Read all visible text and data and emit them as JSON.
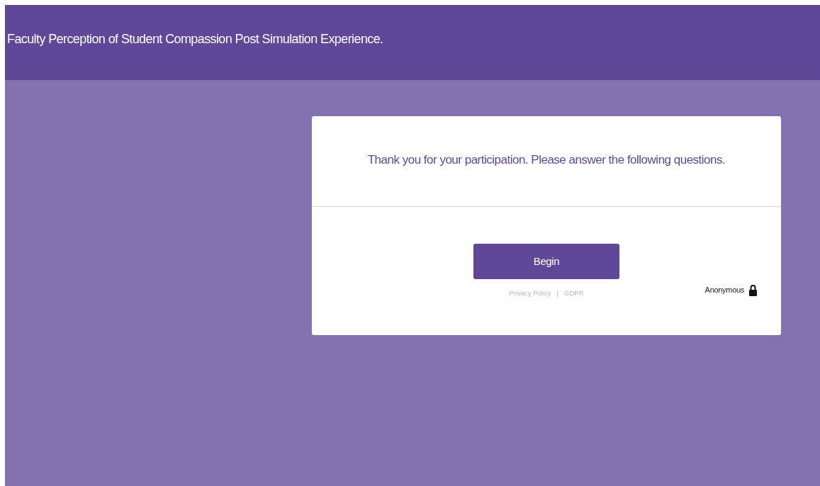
{
  "header": {
    "title": "Faculty Perception of Student Compassion Post Simulation Experience."
  },
  "card": {
    "intro": "Thank you for your participation. Please answer the following questions.",
    "button": "Begin",
    "links": [
      "Privacy Policy",
      "GDPR"
    ],
    "separator": "|",
    "anonymous": "Anonymous"
  }
}
